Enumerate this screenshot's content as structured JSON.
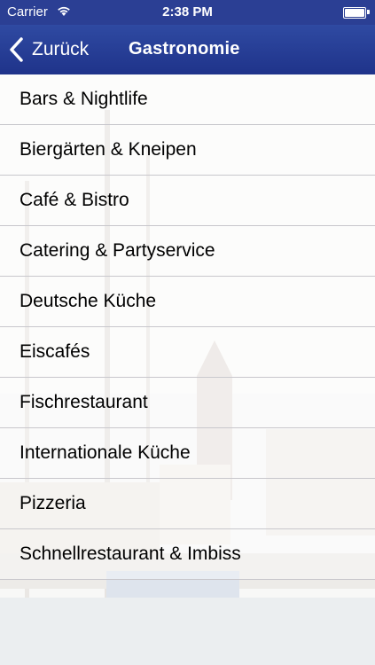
{
  "status_bar": {
    "carrier": "Carrier",
    "time": "2:38 PM",
    "wifi_icon": "wifi-icon",
    "battery_icon": "battery-icon",
    "battery_level": 1.0
  },
  "nav": {
    "back_label": "Zurück",
    "back_icon": "chevron-left-icon",
    "title": "Gastronomie"
  },
  "categories": [
    "Bars & Nightlife",
    "Biergärten & Kneipen",
    "Café & Bistro",
    "Catering & Partyservice",
    "Deutsche Küche",
    "Eiscafés",
    "Fischrestaurant",
    "Internationale Küche",
    "Pizzeria",
    "Schnellrestaurant & Imbiss"
  ],
  "colors": {
    "nav_bar": "#2b3f94",
    "separator": "#c8c7cc",
    "text": "#000000"
  }
}
